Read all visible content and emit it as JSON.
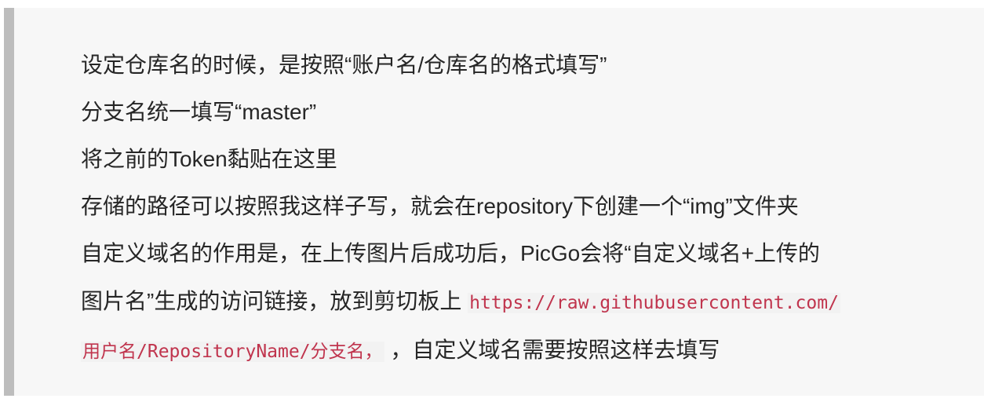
{
  "blockquote": {
    "lines": [
      "设定仓库名的时候，是按照“账户名/仓库名的格式填写”",
      "分支名统一填写“master”",
      "将之前的Token黏贴在这里",
      "存储的路径可以按照我这样子写，就会在repository下创建一个“img”文件夹",
      "自定义域名的作用是，在上传图片后成功后，PicGo会将“自定义域名+上传的"
    ],
    "line6_text": "图片名”生成的访问链接，放到剪切板上 ",
    "line6_code": "https://raw.githubusercontent.com/",
    "line7_code": "用户名/RepositoryName/分支名，",
    "line7_text": " ，自定义域名需要按照这样去填写"
  }
}
